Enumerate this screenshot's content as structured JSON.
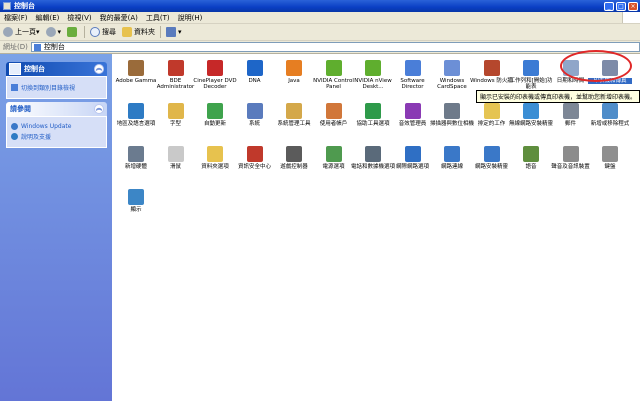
{
  "window": {
    "title": "控制台"
  },
  "menu": [
    "檔案(F)",
    "編輯(E)",
    "檢視(V)",
    "我的最愛(A)",
    "工具(T)",
    "說明(H)"
  ],
  "toolbar": {
    "back_label": "上一頁",
    "search_label": "搜尋",
    "folders_label": "資料夾"
  },
  "address": {
    "label": "網址(D)",
    "value": "控制台"
  },
  "left_pane": {
    "control_panel_title": "控制台",
    "switch_view_link": "切換到類別目錄檢視",
    "see_also_title": "請參閱",
    "see_also_links": [
      "Windows Update",
      "說明及支援"
    ]
  },
  "items": [
    {
      "label": "Adobe Gamma",
      "icon": "adobe-gamma-icon",
      "color": "#9a6b3a"
    },
    {
      "label": "BDE Administrator",
      "icon": "bde-admin-icon",
      "color": "#c0392b"
    },
    {
      "label": "CinePlayer DVD Decoder",
      "icon": "cineplayer-icon",
      "color": "#c62828"
    },
    {
      "label": "DNA",
      "icon": "dna-icon",
      "color": "#1e66c8"
    },
    {
      "label": "Java",
      "icon": "java-icon",
      "color": "#e67e22"
    },
    {
      "label": "NVIDIA Control Panel",
      "icon": "nvidia-icon",
      "color": "#5fae2e"
    },
    {
      "label": "NVIDIA nView Deskt...",
      "icon": "nvidia-nview-icon",
      "color": "#5fae2e"
    },
    {
      "label": "Software Director",
      "icon": "software-director-icon",
      "color": "#4a7ed8"
    },
    {
      "label": "Windows CardSpace",
      "icon": "cardspace-icon",
      "color": "#6c8fd6"
    },
    {
      "label": "Windows 防火牆",
      "icon": "firewall-icon",
      "color": "#b5472d"
    },
    {
      "label": "工作列和[開始]功能表",
      "icon": "taskbar-icon",
      "color": "#3b7bd4"
    },
    {
      "label": "日期和時間",
      "icon": "clock-icon",
      "color": "#8fa6c9"
    },
    {
      "label": "印表機和傳真",
      "icon": "printer-icon",
      "color": "#7d8ba8"
    },
    {
      "label": "地區及語言選項",
      "icon": "globe-icon",
      "color": "#2e7bc4"
    },
    {
      "label": "字型",
      "icon": "fonts-icon",
      "color": "#e0b64a"
    },
    {
      "label": "自動更新",
      "icon": "auto-update-icon",
      "color": "#3fa34d"
    },
    {
      "label": "系統",
      "icon": "system-icon",
      "color": "#5a7bbd"
    },
    {
      "label": "系統管理工具",
      "icon": "admin-tools-icon",
      "color": "#d4a84a"
    },
    {
      "label": "使用者帳戶",
      "icon": "users-icon",
      "color": "#d1773a"
    },
    {
      "label": "協助工具選項",
      "icon": "accessibility-icon",
      "color": "#2e9a4a"
    },
    {
      "label": "音效管理員",
      "icon": "sound-manager-icon",
      "color": "#8a3ab4"
    },
    {
      "label": "掃描器與數位相機",
      "icon": "scanner-icon",
      "color": "#6e7a8a"
    },
    {
      "label": "排定的工作",
      "icon": "scheduled-tasks-icon",
      "color": "#e5c452"
    },
    {
      "label": "無線網路安裝精靈",
      "icon": "wireless-icon",
      "color": "#3b8ed4"
    },
    {
      "label": "郵件",
      "icon": "mail-icon",
      "color": "#7d8796"
    },
    {
      "label": "新增或移除程式",
      "icon": "add-remove-icon",
      "color": "#4f8dc9"
    },
    {
      "label": "新增硬體",
      "icon": "add-hardware-icon",
      "color": "#6b7b8f"
    },
    {
      "label": "滑鼠",
      "icon": "mouse-icon",
      "color": "#c9c9c9"
    },
    {
      "label": "資料夾選項",
      "icon": "folder-options-icon",
      "color": "#e7c24e"
    },
    {
      "label": "資訊安全中心",
      "icon": "security-center-icon",
      "color": "#c0392b"
    },
    {
      "label": "遊戲控制器",
      "icon": "game-controller-icon",
      "color": "#5b5b5b"
    },
    {
      "label": "電源選項",
      "icon": "power-icon",
      "color": "#4f9a4f"
    },
    {
      "label": "電話和數據機選項",
      "icon": "phone-modem-icon",
      "color": "#5a6a7a"
    },
    {
      "label": "網際網路選項",
      "icon": "internet-options-icon",
      "color": "#2f6fc4"
    },
    {
      "label": "網路連線",
      "icon": "network-connections-icon",
      "color": "#3a78c8"
    },
    {
      "label": "網路安裝精靈",
      "icon": "network-setup-icon",
      "color": "#3a78c8"
    },
    {
      "label": "語音",
      "icon": "speech-icon",
      "color": "#5f8e3e"
    },
    {
      "label": "聲音及音訊裝置",
      "icon": "audio-icon",
      "color": "#8c8c8c"
    },
    {
      "label": "鍵盤",
      "icon": "keyboard-icon",
      "color": "#8f8f8f"
    },
    {
      "label": "顯示",
      "icon": "display-icon",
      "color": "#3c86c6"
    }
  ],
  "selected_index": 12,
  "tooltip": "顯示已安裝的印表機或傳真印表機，並幫助您新增印表機。",
  "colors": {
    "titlebar": "#0a3fc4",
    "leftpane": "#6f8fe0",
    "highlight": "#e02828",
    "selection": "#316ac5"
  }
}
